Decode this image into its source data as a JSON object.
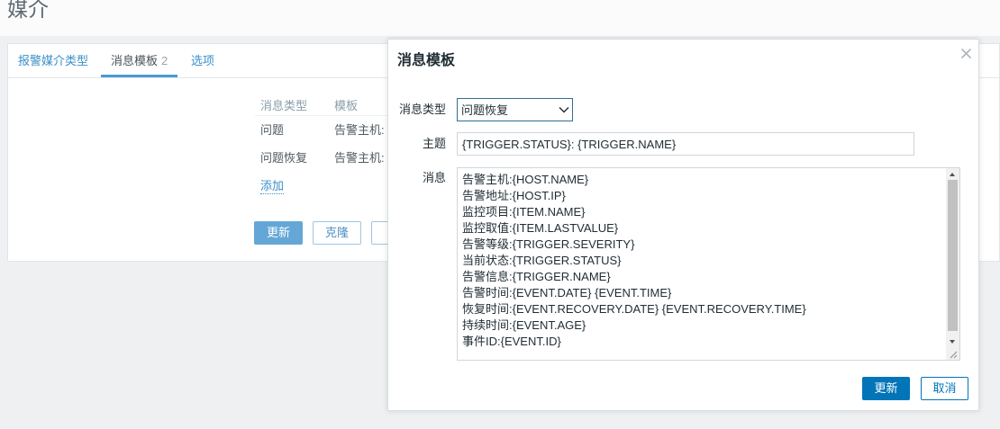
{
  "page": {
    "title": "媒介"
  },
  "tabs": [
    {
      "label": "报警媒介类型"
    },
    {
      "label": "消息模板",
      "count": "2"
    },
    {
      "label": "选项"
    }
  ],
  "message_templates": {
    "columns": [
      "消息类型",
      "模板"
    ],
    "rows": [
      {
        "message_type": "问题",
        "template": "告警主机:"
      },
      {
        "message_type": "问题恢复",
        "template": "告警主机:"
      }
    ],
    "add_link": "添加"
  },
  "form_actions": {
    "update": "更新",
    "clone": "克隆"
  },
  "dialog": {
    "title": "消息模板",
    "message_type": {
      "label": "消息类型",
      "selected": "问题恢复"
    },
    "subject": {
      "label": "主题",
      "value": "{TRIGGER.STATUS}: {TRIGGER.NAME}"
    },
    "message": {
      "label": "消息",
      "value": "告警主机:{HOST.NAME}\n告警地址:{HOST.IP}\n监控项目:{ITEM.NAME}\n监控取值:{ITEM.LASTVALUE}\n告警等级:{TRIGGER.SEVERITY}\n当前状态:{TRIGGER.STATUS}\n告警信息:{TRIGGER.NAME}\n告警时间:{EVENT.DATE} {EVENT.TIME}\n恢复时间:{EVENT.RECOVERY.DATE} {EVENT.RECOVERY.TIME}\n持续时间:{EVENT.AGE}\n事件ID:{EVENT.ID}"
    },
    "buttons": {
      "update": "更新",
      "cancel": "取消"
    }
  },
  "icons": {
    "dialog_close": "close-icon",
    "select_arrow": "chevron-down-icon",
    "scroll_up": "scroll-up-arrow-icon",
    "scroll_down": "scroll-down-arrow-icon",
    "resize": "resize-grip-icon"
  },
  "colors": {
    "primary": "#0275b8",
    "muted_primary": "#64a7d7",
    "link": "#3a8fc9",
    "text": "#1f2c33",
    "muted_text": "#8a9ea8",
    "border": "#cfd6da",
    "focus_border": "#2f6e96",
    "page_background": "#eef0f2"
  }
}
